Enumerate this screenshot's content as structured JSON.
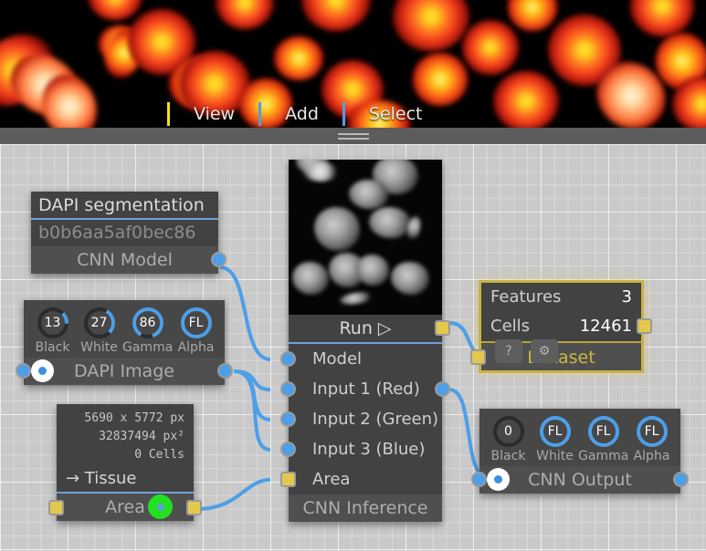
{
  "menu": {
    "items": [
      {
        "label": "View",
        "sep": "yellow"
      },
      {
        "label": "Add",
        "sep": "blue"
      },
      {
        "label": "Select",
        "sep": "blue"
      }
    ]
  },
  "colors": {
    "wire": "#4d9fe8",
    "port_blue": "#4d9fe8",
    "port_yellow": "#e3c84e",
    "selected": "#cdb73f",
    "green_indicator": "#23e023",
    "node_body": "#424242",
    "node_title": "#4f4f4f",
    "canvas": "#c9c9c9"
  },
  "nodes": {
    "model": {
      "name": "DAPI segmentation",
      "hash": "b0b6aa5af0bec86",
      "title": "CNN Model"
    },
    "dapi_image": {
      "title": "DAPI Image",
      "knobs": [
        {
          "label": "Black",
          "value": "13",
          "arc": 0.13
        },
        {
          "label": "White",
          "value": "27",
          "arc": 0.27
        },
        {
          "label": "Gamma",
          "value": "86",
          "arc": 0.86
        },
        {
          "label": "Alpha",
          "value": "FL",
          "arc": 1.0
        }
      ]
    },
    "area": {
      "dimensions": "5690 x 5772 px",
      "pixel_area": "32837494 px²",
      "cells": "0 Cells",
      "link": "→ Tissue",
      "title": "Area"
    },
    "inference": {
      "run_label": "Run ▷",
      "title": "CNN Inference",
      "inputs": [
        {
          "label": "Model",
          "port": "blue"
        },
        {
          "label": "Input 1 (Red)",
          "port": "blue"
        },
        {
          "label": "Input 2 (Green)",
          "port": "blue"
        },
        {
          "label": "Input 3 (Blue)",
          "port": "blue"
        },
        {
          "label": "Area",
          "port": "yellow"
        }
      ]
    },
    "dataset": {
      "features_label": "Features",
      "features_value": "3",
      "cells_label": "Cells",
      "cells_value": "12461",
      "title": "Dataset",
      "help_label": "?",
      "settings_label": "⚙"
    },
    "cnn_output": {
      "title": "CNN Output",
      "knobs": [
        {
          "label": "Black",
          "value": "0",
          "arc": 0.0
        },
        {
          "label": "White",
          "value": "FL",
          "arc": 1.0
        },
        {
          "label": "Gamma",
          "value": "FL",
          "arc": 1.0
        },
        {
          "label": "Alpha",
          "value": "FL",
          "arc": 1.0
        }
      ]
    }
  }
}
